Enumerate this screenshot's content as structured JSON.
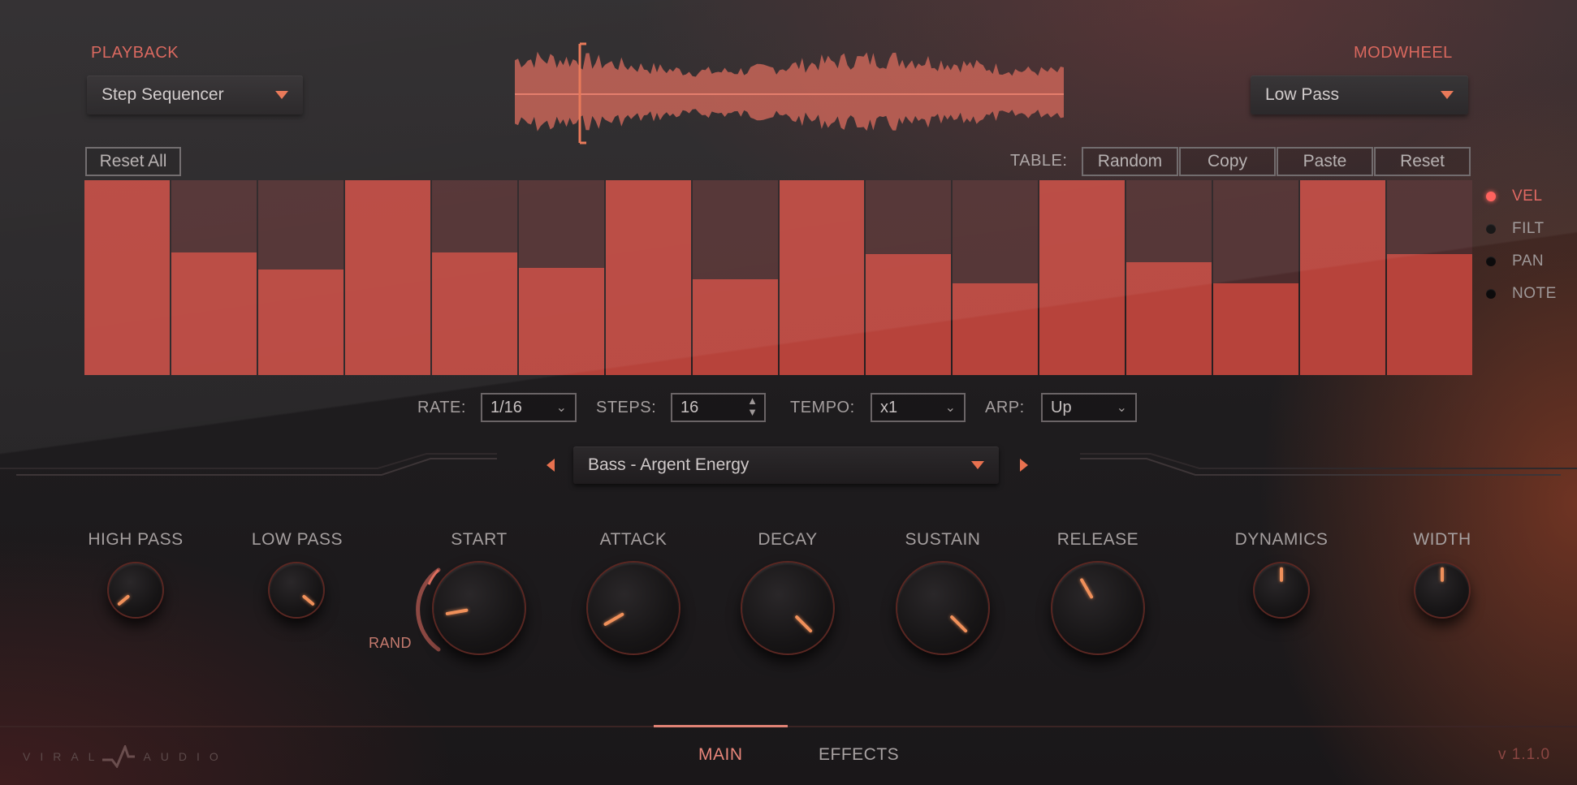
{
  "playback": {
    "label": "PLAYBACK",
    "value": "Step Sequencer"
  },
  "modwheel": {
    "label": "MODWHEEL",
    "value": "Low Pass"
  },
  "sequencer": {
    "reset_all": "Reset All",
    "table_label": "TABLE:",
    "table_buttons": [
      "Random",
      "Copy",
      "Paste",
      "Reset"
    ],
    "steps": [
      1.0,
      0.63,
      0.54,
      1.0,
      0.63,
      0.55,
      1.0,
      0.49,
      1.0,
      0.62,
      0.47,
      1.0,
      0.58,
      0.47,
      1.0,
      0.62
    ],
    "modes": [
      "VEL",
      "FILT",
      "PAN",
      "NOTE"
    ],
    "active_mode": "VEL"
  },
  "params": {
    "rate": {
      "label": "RATE:",
      "value": "1/16"
    },
    "steps": {
      "label": "STEPS:",
      "value": "16"
    },
    "tempo": {
      "label": "TEMPO:",
      "value": "x1"
    },
    "arp": {
      "label": "ARP:",
      "value": "Up"
    }
  },
  "preset": {
    "value": "Bass - Argent Energy"
  },
  "knobs": {
    "high_pass": {
      "label": "HIGH PASS",
      "angle": -130
    },
    "low_pass": {
      "label": "LOW PASS",
      "angle": 130
    },
    "start": {
      "label": "START",
      "angle": -100,
      "rand_label": "RAND"
    },
    "attack": {
      "label": "ATTACK",
      "angle": -120
    },
    "decay": {
      "label": "DECAY",
      "angle": 135
    },
    "sustain": {
      "label": "SUSTAIN",
      "angle": 135
    },
    "release": {
      "label": "RELEASE",
      "angle": -30
    },
    "dynamics": {
      "label": "DYNAMICS",
      "angle": 0
    },
    "width": {
      "label": "WIDTH",
      "angle": 0
    }
  },
  "tabs": {
    "main": "MAIN",
    "effects": "EFFECTS"
  },
  "logo": {
    "left": "VIRAL",
    "right": "AUDIO"
  },
  "version": "v 1.1.0",
  "colors": {
    "accent": "#d75e54",
    "step_fill": "#b7433b",
    "step_bg": "#4d2c2d",
    "pointer": "#f0905a"
  }
}
